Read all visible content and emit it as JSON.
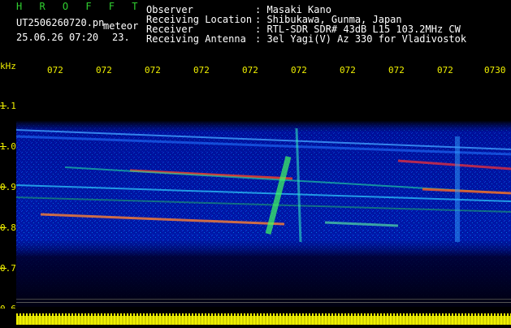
{
  "header": {
    "app_title": "H R O F F T",
    "file_name": "UT2506260720.pn",
    "category": "meteor",
    "datetime": "25.06.26 07:20",
    "detect_count": "23.",
    "fields": [
      {
        "label": "Observer",
        "value": ": Masaki Kano"
      },
      {
        "label": "Receiving Location",
        "value": ": Shibukawa, Gunma, Japan"
      },
      {
        "label": "Receiver",
        "value": ": RTL-SDR SDR# 43dB L15 103.2MHz CW"
      },
      {
        "label": "Receiving Antenna",
        "value": ": 3el Yagi(V) Az 330 for Vladivostok"
      }
    ]
  },
  "axis": {
    "unit": "kHz",
    "time_labels": [
      "072",
      "072",
      "072",
      "072",
      "072",
      "072",
      "072",
      "072",
      "072",
      "0730"
    ],
    "freq_labels": [
      "1.1",
      "1.0",
      "0.9",
      "0.8",
      "0.7",
      "0.6"
    ]
  },
  "colors": {
    "background": "#000000",
    "spectrogram_base": "#00008a",
    "label_yellow": "#f0f000",
    "title_green": "#30d030"
  }
}
